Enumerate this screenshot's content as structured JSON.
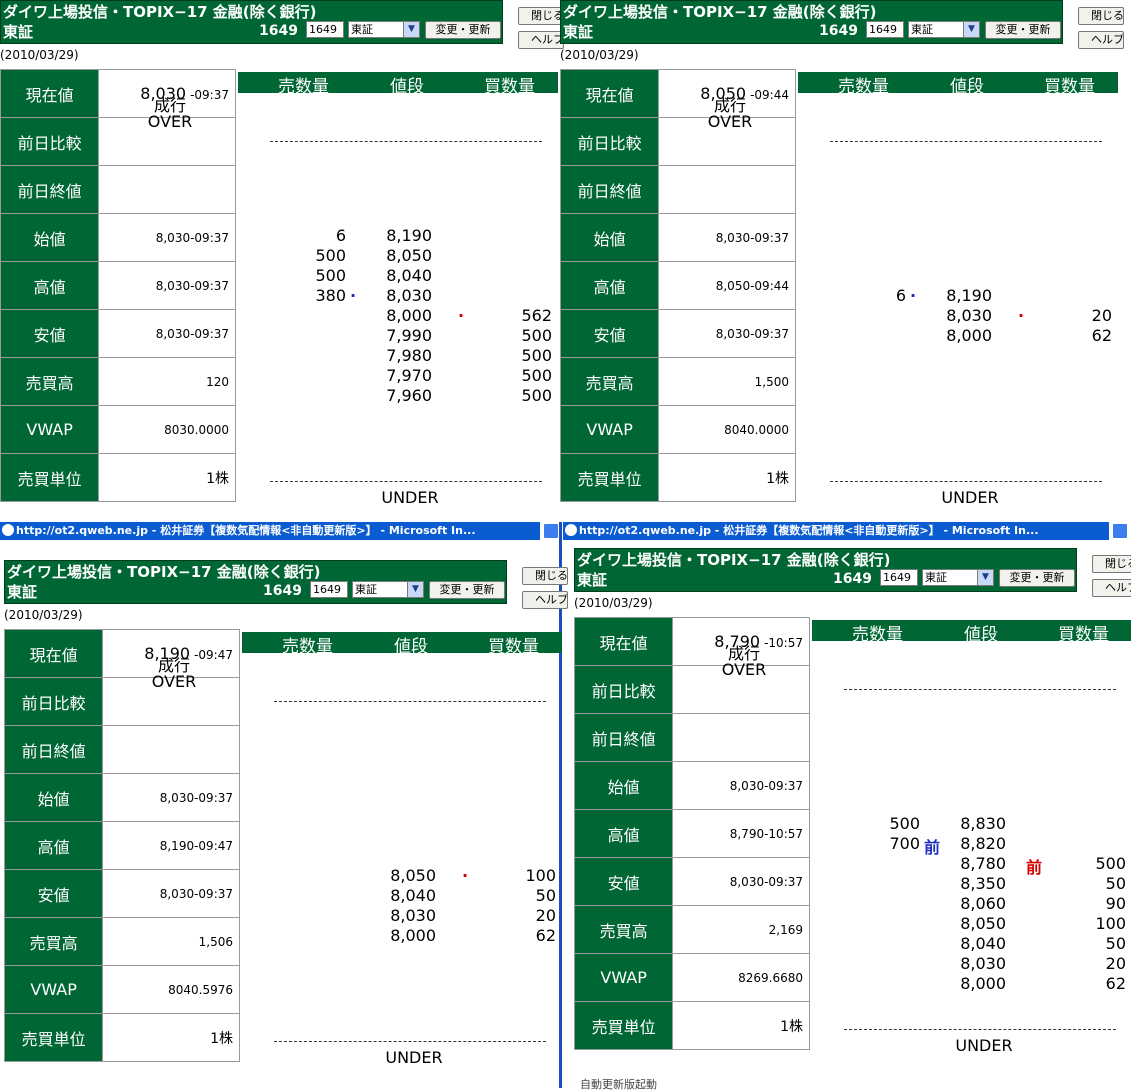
{
  "common": {
    "title": "ダイワ上場投信・TOPIX−17 金融(除く銀行)",
    "exchange": "東証",
    "code": "1649",
    "code_input": "1649",
    "select_value": "東証",
    "change_button": "変更・更新",
    "close_button": "閉じる",
    "help_button": "ヘルプ",
    "date": "(2010/03/29)",
    "labels": [
      "現在値",
      "前日比較",
      "前日終値",
      "始値",
      "高値",
      "安値",
      "売買高",
      "VWAP",
      "売買単位"
    ],
    "ob_sell": "売数量",
    "ob_price": "値段",
    "ob_buy": "買数量",
    "market_order": "成行",
    "over": "OVER",
    "under": "UNDER",
    "unit": "1株",
    "browser_title": "http://ot2.qweb.ne.jp - 松井証券【複数気配情報<非自動更新版>】 - Microsoft In...",
    "status_text": "自動更新版起動"
  },
  "panels": [
    {
      "current_price": "8,030",
      "current_time": "-09:37",
      "open": "8,030-09:37",
      "high": "8,030-09:37",
      "low": "8,030-09:37",
      "volume": "120",
      "vwap": "8030.0000",
      "book": [
        {
          "sell": "6",
          "price": "8,190",
          "buy": "",
          "sell_mark": "",
          "buy_mark": ""
        },
        {
          "sell": "500",
          "price": "8,050",
          "buy": "",
          "sell_mark": "",
          "buy_mark": ""
        },
        {
          "sell": "500",
          "price": "8,040",
          "buy": "",
          "sell_mark": "",
          "buy_mark": ""
        },
        {
          "sell": "380",
          "price": "8,030",
          "buy": "",
          "sell_mark": "dot",
          "buy_mark": ""
        },
        {
          "sell": "",
          "price": "8,000",
          "buy": "562",
          "sell_mark": "",
          "buy_mark": "dot"
        },
        {
          "sell": "",
          "price": "7,990",
          "buy": "500",
          "sell_mark": "",
          "buy_mark": ""
        },
        {
          "sell": "",
          "price": "7,980",
          "buy": "500",
          "sell_mark": "",
          "buy_mark": ""
        },
        {
          "sell": "",
          "price": "7,970",
          "buy": "500",
          "sell_mark": "",
          "buy_mark": ""
        },
        {
          "sell": "",
          "price": "7,960",
          "buy": "500",
          "sell_mark": "",
          "buy_mark": ""
        }
      ]
    },
    {
      "current_price": "8,050",
      "current_time": "-09:44",
      "open": "8,030-09:37",
      "high": "8,050-09:44",
      "low": "8,030-09:37",
      "volume": "1,500",
      "vwap": "8040.0000",
      "book": [
        {
          "sell": "6",
          "price": "8,190",
          "buy": "",
          "sell_mark": "dot",
          "buy_mark": ""
        },
        {
          "sell": "",
          "price": "8,030",
          "buy": "20",
          "sell_mark": "",
          "buy_mark": "dot"
        },
        {
          "sell": "",
          "price": "8,000",
          "buy": "62",
          "sell_mark": "",
          "buy_mark": ""
        }
      ]
    },
    {
      "current_price": "8,190",
      "current_time": "-09:47",
      "open": "8,030-09:37",
      "high": "8,190-09:47",
      "low": "8,030-09:37",
      "volume": "1,506",
      "vwap": "8040.5976",
      "book": [
        {
          "sell": "",
          "price": "8,050",
          "buy": "100",
          "sell_mark": "",
          "buy_mark": "dot"
        },
        {
          "sell": "",
          "price": "8,040",
          "buy": "50",
          "sell_mark": "",
          "buy_mark": ""
        },
        {
          "sell": "",
          "price": "8,030",
          "buy": "20",
          "sell_mark": "",
          "buy_mark": ""
        },
        {
          "sell": "",
          "price": "8,000",
          "buy": "62",
          "sell_mark": "",
          "buy_mark": ""
        }
      ]
    },
    {
      "current_price": "8,790",
      "current_time": "-10:57",
      "open": "8,030-09:37",
      "high": "8,790-10:57",
      "low": "8,030-09:37",
      "volume": "2,169",
      "vwap": "8269.6680",
      "book": [
        {
          "sell": "500",
          "price": "8,830",
          "buy": "",
          "sell_mark": "",
          "buy_mark": ""
        },
        {
          "sell": "700",
          "price": "8,820",
          "buy": "",
          "sell_mark": "前",
          "buy_mark": ""
        },
        {
          "sell": "",
          "price": "8,780",
          "buy": "500",
          "sell_mark": "",
          "buy_mark": "前"
        },
        {
          "sell": "",
          "price": "8,350",
          "buy": "50",
          "sell_mark": "",
          "buy_mark": ""
        },
        {
          "sell": "",
          "price": "8,060",
          "buy": "90",
          "sell_mark": "",
          "buy_mark": ""
        },
        {
          "sell": "",
          "price": "8,050",
          "buy": "100",
          "sell_mark": "",
          "buy_mark": ""
        },
        {
          "sell": "",
          "price": "8,040",
          "buy": "50",
          "sell_mark": "",
          "buy_mark": ""
        },
        {
          "sell": "",
          "price": "8,030",
          "buy": "20",
          "sell_mark": "",
          "buy_mark": ""
        },
        {
          "sell": "",
          "price": "8,000",
          "buy": "62",
          "sell_mark": "",
          "buy_mark": ""
        }
      ]
    }
  ]
}
